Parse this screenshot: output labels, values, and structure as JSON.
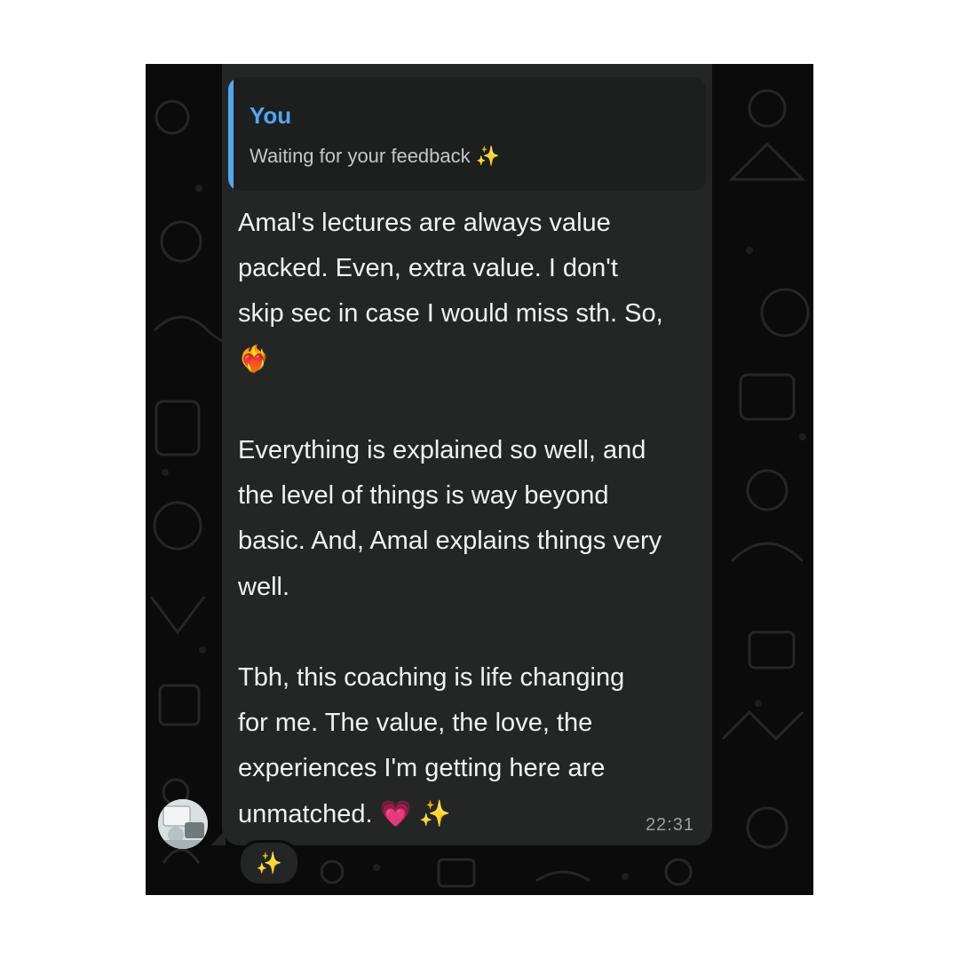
{
  "reply": {
    "sender": "You",
    "text": "Waiting for your feedback ✨"
  },
  "message": {
    "paragraphs": [
      [
        "Amal's lectures are always value",
        "packed. Even, extra value. I don't",
        "skip sec in case I would miss sth. So,"
      ],
      [
        "Everything is explained so well, and",
        "the level of things is way beyond",
        "basic. And, Amal explains things very",
        "well."
      ],
      [
        "Tbh, this coaching is life changing",
        "for me. The value, the love, the",
        "experiences I'm getting here are",
        "unmatched."
      ]
    ],
    "end_emoji": "💗 ✨",
    "heart_on_fire_emoji": "❤️‍🔥",
    "time": "22:31"
  },
  "reaction": {
    "emoji": "✨"
  },
  "colors": {
    "background": "#0b0b0b",
    "bubble": "#242626",
    "reply_accent": "#53a6f2",
    "text": "#f1f1f1",
    "timestamp": "#9aa0a0"
  }
}
